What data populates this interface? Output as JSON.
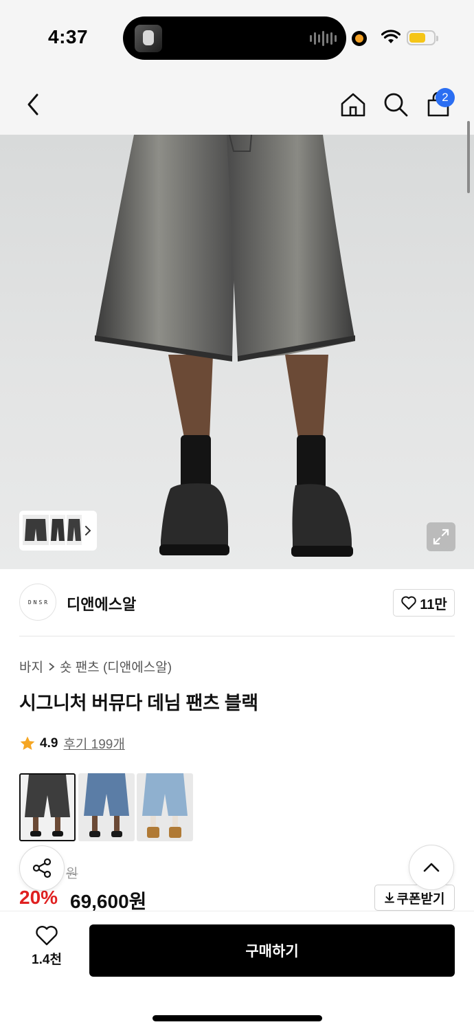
{
  "status_bar": {
    "time": "4:37"
  },
  "nav": {
    "cart_count": "2"
  },
  "brand": {
    "logo_text": "DNSR",
    "name": "디앤에스알",
    "likes": "11만"
  },
  "breadcrumb": {
    "category": "바지",
    "subcategory": "숏 팬츠 (디앤에스알)"
  },
  "product": {
    "title": "시그니처 버뮤다 데님 팬츠 블랙",
    "rating": "4.9",
    "reviews": "후기 199개",
    "original_price_suffix": "원",
    "discount": "20%",
    "price": "69,600원"
  },
  "variants": [
    {
      "name": "black-wash"
    },
    {
      "name": "mid-blue"
    },
    {
      "name": "light-blue"
    }
  ],
  "coupon": {
    "label": "쿠폰받기"
  },
  "bottom_bar": {
    "wish_count": "1.4천",
    "buy_label": "구매하기"
  },
  "colors": {
    "accent_discount": "#e02020",
    "badge": "#2b6ef2",
    "star": "#f5a623",
    "button": "#000000"
  }
}
